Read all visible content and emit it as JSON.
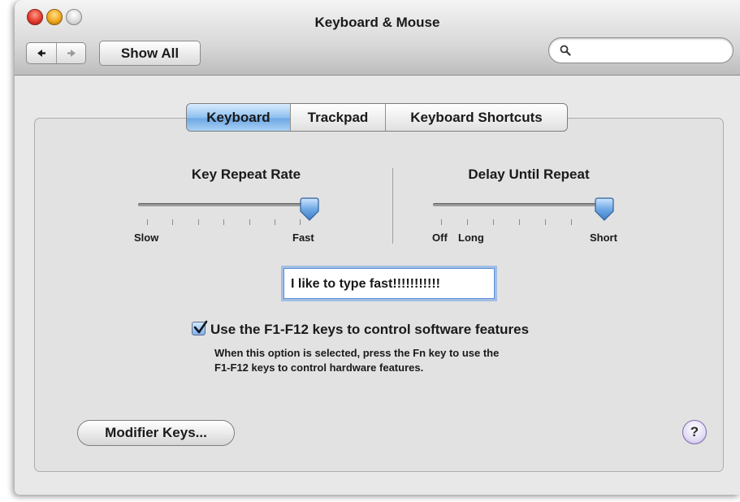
{
  "window": {
    "title": "Keyboard & Mouse"
  },
  "toolbar": {
    "show_all_label": "Show All",
    "search_value": "",
    "search_icon": "magnifier-icon",
    "back_icon": "back-arrow-icon",
    "forward_icon": "forward-arrow-icon"
  },
  "tabs": [
    {
      "label": "Keyboard",
      "selected": true
    },
    {
      "label": "Trackpad",
      "selected": false
    },
    {
      "label": "Keyboard Shortcuts",
      "selected": false
    }
  ],
  "key_repeat": {
    "heading": "Key Repeat Rate",
    "min_label": "Slow",
    "max_label": "Fast",
    "value_fraction": 1.0
  },
  "delay_repeat": {
    "heading": "Delay Until Repeat",
    "off_label": "Off",
    "min_label": "Long",
    "max_label": "Short",
    "value_fraction": 1.0
  },
  "test_field": {
    "value": "I like to type fast!!!!!!!!!!!"
  },
  "fn_keys_option": {
    "checked": true,
    "label": "Use the F1-F12 keys to control software features",
    "help_line1": "When this option is selected, press the Fn key to use the",
    "help_line2": "F1-F12 keys to control hardware features."
  },
  "buttons": {
    "modifier_keys_label": "Modifier Keys...",
    "help_label": "?"
  },
  "colors": {
    "selected_tab": "#8fc1ef",
    "slider_knob": "#6fa8e4",
    "help_button": "#b9a9e0"
  }
}
